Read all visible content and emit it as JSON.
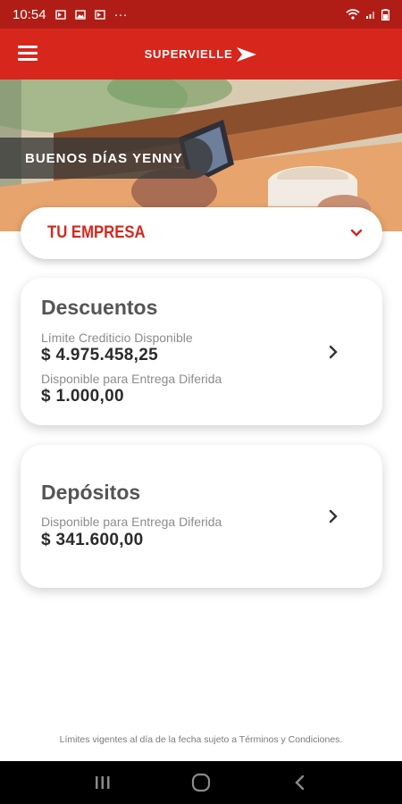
{
  "status_bar": {
    "time": "10:54",
    "more": "···"
  },
  "brand": {
    "name": "SUPERVIELLE"
  },
  "greeting": "BUENOS DÍAS YENNY",
  "company_selector": {
    "label": "TU EMPRESA"
  },
  "cards": {
    "descuentos": {
      "title": "Descuentos",
      "line1_label": "Límite Crediticio Disponible",
      "line1_amount": "$ 4.975.458,25",
      "line2_label": "Disponible para Entrega Diferida",
      "line2_amount": "$ 1.000,00"
    },
    "depositos": {
      "title": "Depósitos",
      "line1_label": "Disponible para Entrega Diferida",
      "line1_amount": "$ 341.600,00"
    }
  },
  "footnote": "Límites vigentes al día de la fecha sujeto a Términos y Condiciones.",
  "colors": {
    "primary": "#d7261c",
    "status_bar": "#b01d17"
  }
}
